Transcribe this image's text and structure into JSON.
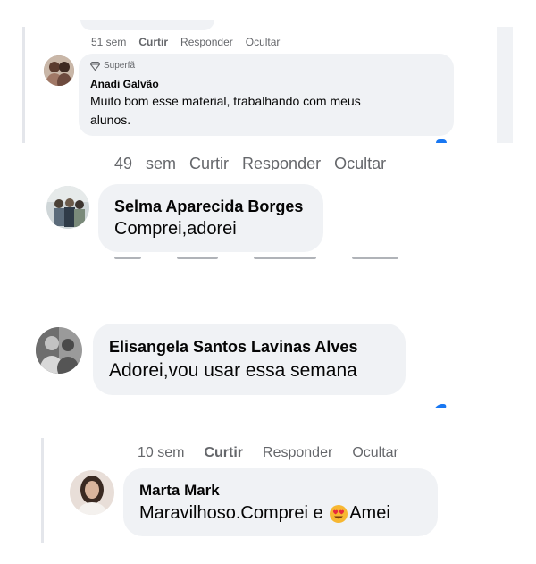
{
  "comments": [
    {
      "id": "c1",
      "time": "51 sem",
      "like": "Curtir",
      "reply": "Responder",
      "hide": "Ocultar",
      "badge": "Superfã",
      "badge_icon": "diamond-icon",
      "name": "Anadi Galvão",
      "text_line1": "Muito bom esse material, trabalhando com meus",
      "text_line2": "alunos."
    },
    {
      "id": "c2",
      "partial_top_text": "49 sem   Curtir   Responder   Ocultar",
      "name": "Selma Aparecida Borges",
      "text": "Comprei,adorei"
    },
    {
      "id": "c3",
      "name": "Elisangela Santos Lavinas Alves",
      "text": "Adorei,vou usar essa semana"
    },
    {
      "id": "c4",
      "time": "10 sem",
      "like": "Curtir",
      "reply": "Responder",
      "hide": "Ocultar",
      "name": "Marta Mark",
      "text_before_emoji": "Maravilhoso.Comprei e ",
      "emoji": "heart-eyes-emoji",
      "text_after_emoji": "Amei"
    }
  ],
  "colors": {
    "bubble": "#f0f2f5",
    "meta_text": "#65676b",
    "thread_line": "#e4e6eb",
    "accent": "#1877f2"
  }
}
